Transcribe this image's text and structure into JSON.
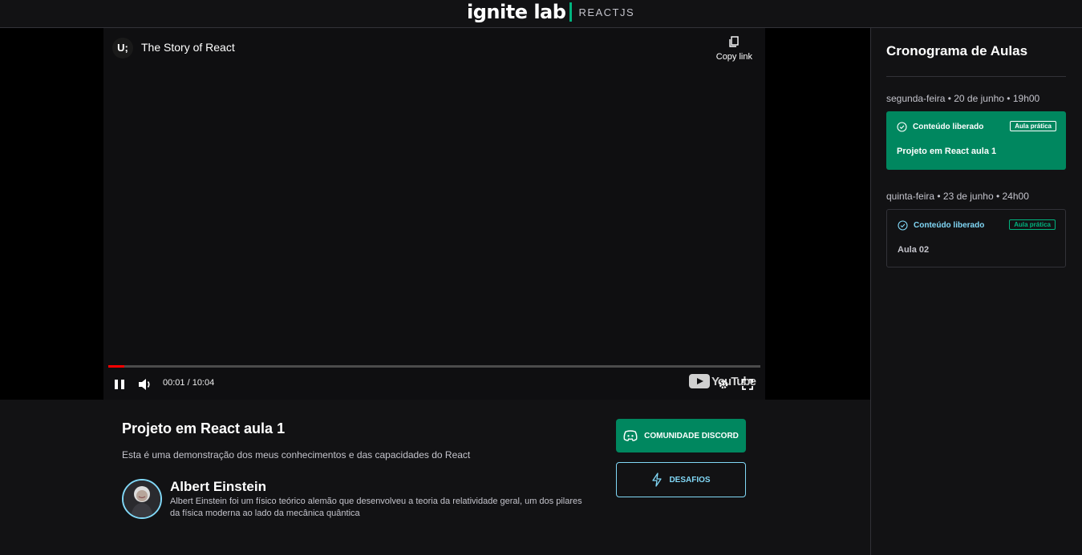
{
  "header": {
    "logo_word": "ignite lab",
    "logo_sub": "REACTJS"
  },
  "player": {
    "channel_badge": "U;",
    "video_title": "The Story of React",
    "copy_link": "Copy link",
    "time": "00:01 / 10:04",
    "progress_fraction": 0.003,
    "youtube_label": "YouTube"
  },
  "lesson": {
    "title": "Projeto em React aula 1",
    "description": "Esta é uma demonstração dos meus conhecimentos e das capacidades do React"
  },
  "teacher": {
    "name": "Albert Einstein",
    "bio": "Albert Einstein foi um físico teórico alemão que desenvolveu a teoria da relatividade geral, um dos pilares da física moderna ao lado da mecânica quântica"
  },
  "buttons": {
    "discord": "COMUNIDADE DISCORD",
    "desafios": "DESAFIOS"
  },
  "sidebar": {
    "title": "Cronograma de Aulas",
    "lessons": [
      {
        "date": "segunda-feira • 20 de junho • 19h00",
        "status": "Conteúdo liberado",
        "badge": "Aula prática",
        "name": "Projeto em React aula 1",
        "active": true
      },
      {
        "date": "quinta-feira • 23 de junho • 24h00",
        "status": "Conteúdo liberado",
        "badge": "Aula prática",
        "name": "Aula 02",
        "active": false
      }
    ]
  },
  "colors": {
    "background": "#121214",
    "accent_green": "#00875f",
    "accent_blue": "#81d8f7"
  }
}
